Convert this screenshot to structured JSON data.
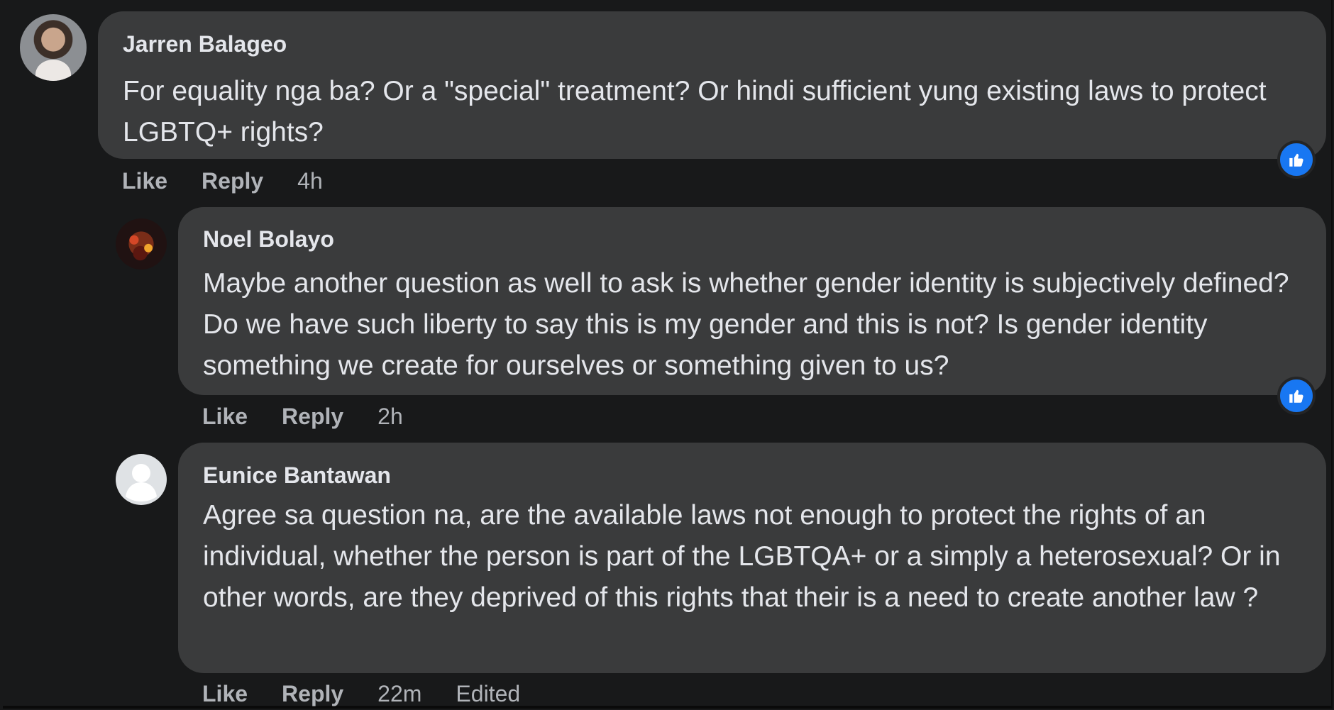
{
  "comments": [
    {
      "author": "Jarren Balageo",
      "text": "For equality nga ba? Or a \"special\" treatment? Or hindi sufficient yung existing laws to protect LGBTQ+ rights?",
      "actions": {
        "like": "Like",
        "reply": "Reply",
        "time": "4h"
      }
    },
    {
      "author": "Noel Bolayo",
      "text": "Maybe another question as well to ask is whether gender identity is subjectively defined? Do we have such liberty to say this is my gender and this is not? Is gender identity something we create for ourselves or something given to us?",
      "actions": {
        "like": "Like",
        "reply": "Reply",
        "time": "2h"
      }
    },
    {
      "author": "Eunice Bantawan",
      "text": "Agree sa question na, are the available laws not enough to protect the rights of an individual, whether the person is part of the LGBTQA+ or a simply a heterosexual? Or in other words, are they deprived of this rights that their is a need to create another law ?",
      "actions": {
        "like": "Like",
        "reply": "Reply",
        "time": "22m",
        "edited": "Edited"
      }
    }
  ],
  "icons": {
    "reaction": "like-reaction-icon",
    "default_avatar": "default-profile-icon"
  },
  "colors": {
    "background": "#18191a",
    "bubble": "#3a3b3c",
    "text": "#e4e6eb",
    "secondary_text": "#b0b3b8",
    "like_blue": "#1877f2"
  }
}
